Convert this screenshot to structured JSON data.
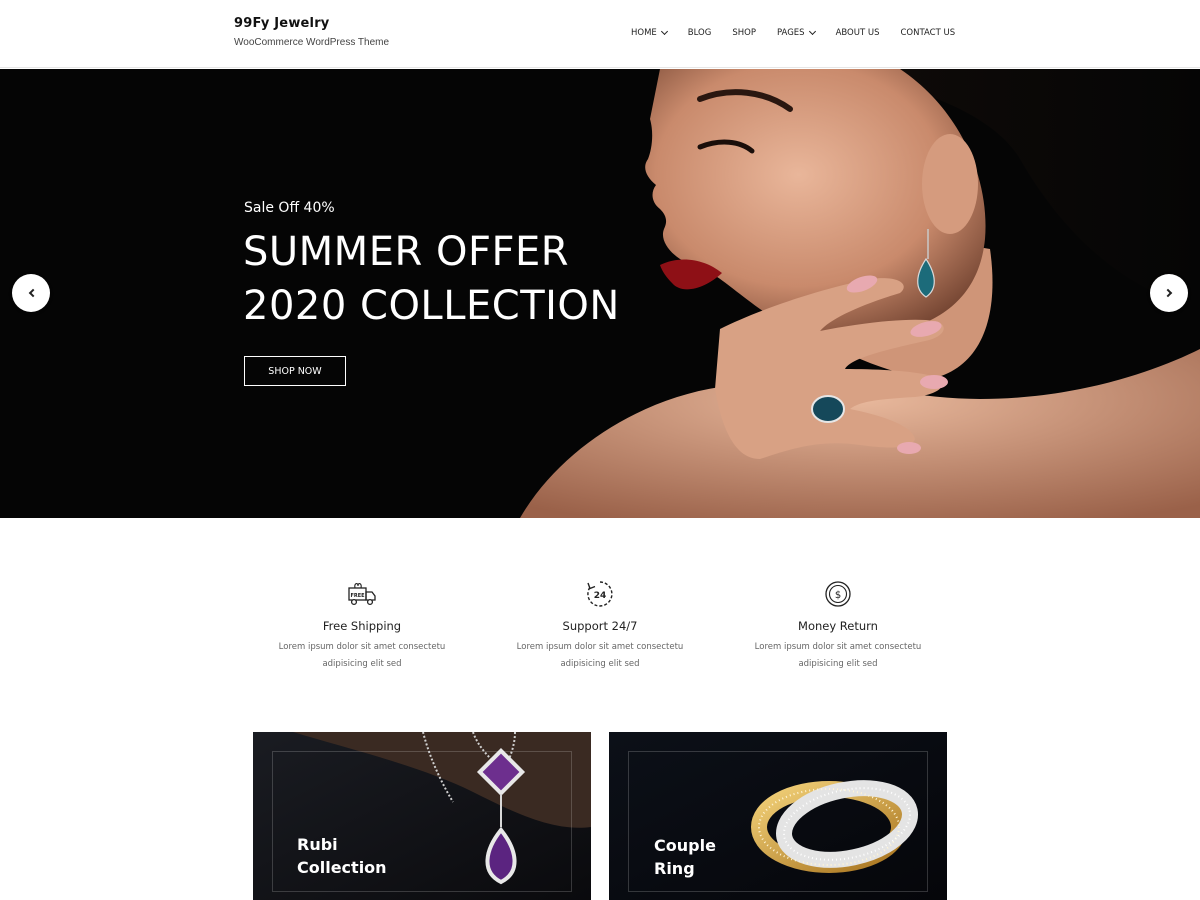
{
  "header": {
    "site_title": "99Fy Jewelry",
    "tagline": "WooCommerce WordPress Theme",
    "nav": [
      {
        "label": "HOME",
        "has_dropdown": true
      },
      {
        "label": "BLOG",
        "has_dropdown": false
      },
      {
        "label": "SHOP",
        "has_dropdown": false
      },
      {
        "label": "PAGES",
        "has_dropdown": true
      },
      {
        "label": "ABOUT US",
        "has_dropdown": false
      },
      {
        "label": "CONTACT US",
        "has_dropdown": false
      }
    ]
  },
  "hero": {
    "subtitle": "Sale Off 40%",
    "title_line1": "SUMMER OFFER",
    "title_line2": "2020 COLLECTION",
    "cta_label": "SHOP NOW",
    "prev_icon": "chevron-left-icon",
    "next_icon": "chevron-right-icon"
  },
  "features": [
    {
      "icon": "free-delivery-truck-icon",
      "icon_text": "FREE",
      "title": "Free Shipping",
      "desc_line1": "Lorem ipsum dolor sit amet consectetu",
      "desc_line2": "adipisicing elit sed"
    },
    {
      "icon": "support-24-icon",
      "icon_text": "24",
      "title": "Support 24/7",
      "desc_line1": "Lorem ipsum dolor sit amet consectetu",
      "desc_line2": "adipisicing elit sed"
    },
    {
      "icon": "money-return-icon",
      "icon_text": "$",
      "title": "Money Return",
      "desc_line1": "Lorem ipsum dolor sit amet consectetu",
      "desc_line2": "adipisicing elit sed"
    }
  ],
  "collections": [
    {
      "line1": "Rubi",
      "line2": "Collection"
    },
    {
      "line1": "Couple",
      "line2": "Ring"
    }
  ],
  "colors": {
    "hero_background": "#050505",
    "text_dark": "#222222",
    "muted_text": "#666666",
    "collection_background": "#0c0c10"
  }
}
